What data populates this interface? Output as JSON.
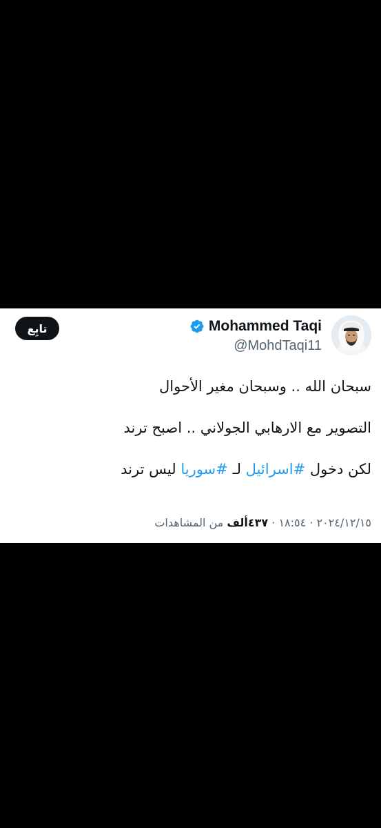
{
  "tweet": {
    "author": {
      "display_name": "Mohammed Taqi",
      "handle": "@MohdTaqi11",
      "verified_icon": "verified-badge-icon",
      "avatar_icon": "profile-photo"
    },
    "follow_label": "تابِع",
    "text": {
      "line1": "سبحان الله .. وسبحان مغير الأحوال",
      "line2": "التصوير مع الارهابي الجولاني .. اصبح ترند",
      "line3_prefix": "لكن دخول ",
      "hashtag1": "#اسرائيل",
      "line3_middle": " لـ ",
      "hashtag2": "#سوريا",
      "line3_suffix": " ليس ترند"
    },
    "meta": {
      "date": "٢٠٢٤/١٢/١٥",
      "separator": " · ",
      "time": "١٨:٥٤",
      "views_count": "٤٣٧ألف",
      "views_label": " من المشاهدات"
    }
  },
  "colors": {
    "background": "#000000",
    "card": "#ffffff",
    "text": "#0f1419",
    "secondary": "#536471",
    "link": "#1d9bf0",
    "verified": "#1d9bf0"
  }
}
